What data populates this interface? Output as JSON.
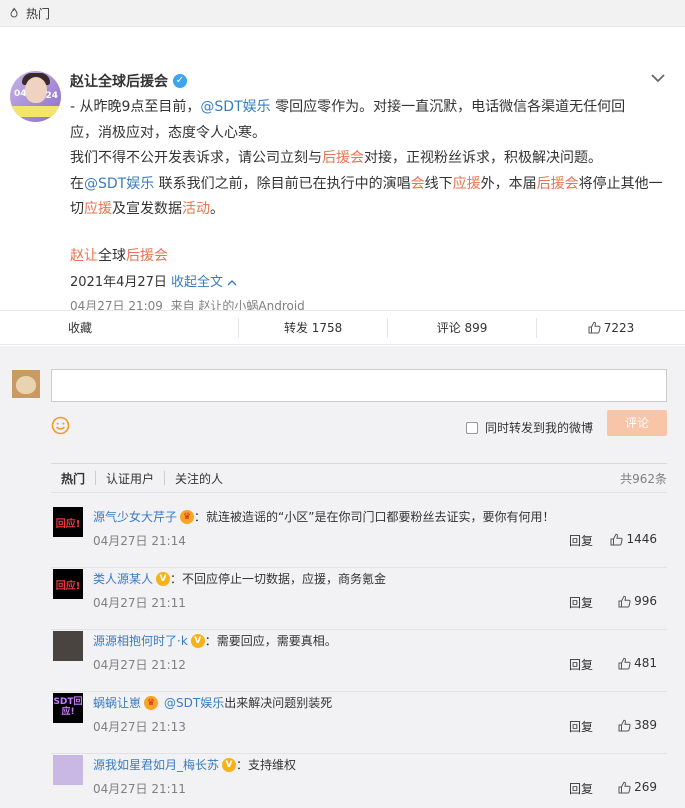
{
  "topbar": {
    "label": "热门"
  },
  "post": {
    "author": "赵让全球后援会",
    "avatar_text_left": "04",
    "avatar_text_right": "24",
    "line1_a": "- 从昨晚9点至目前，",
    "line1_at": "@SDT娱乐",
    "line1_b": " 零回应零作为。对接一直沉默，电话微信各渠道无任何回",
    "line2": "应，消极应对，态度令人心寒。",
    "line3_a": "我们不得不公开发表诉求，请公司立刻与",
    "line3_link": "后援会",
    "line3_b": "对接，正视粉丝诉求，积极解决问题。",
    "line4_a": "在",
    "line4_at": "@SDT娱乐",
    "line4_b": " 联系我们之前，除目前已在执行中的演唱",
    "line4_link1": "会",
    "line4_c": "线下",
    "line4_link2": "应援",
    "line4_d": "外，本届",
    "line4_link3": "后援会",
    "line4_e": "将停止其他一",
    "line5_a": "切",
    "line5_link1": "应援",
    "line5_b": "及宣发数据",
    "line5_link2": "活动",
    "line5_c": "。",
    "sig_a": "赵让",
    "sig_b": "全球",
    "sig_link": "后援会",
    "date": "2021年4月27日",
    "collapse": "收起全文",
    "meta_time": "04月27日 21:09",
    "meta_from": "来自 赵让的小蜗Android"
  },
  "actions": {
    "favorite": "收藏",
    "repost": "转发 1758",
    "comment": "评论 899",
    "like": "7223"
  },
  "composer": {
    "forward_label": "同时转发到我的微博",
    "submit": "评论"
  },
  "tabs": {
    "hot": "热门",
    "verified": "认证用户",
    "following": "关注的人",
    "total": "共962条"
  },
  "comments": [
    {
      "avatar_text": "回应!",
      "name": "源气少女大芹子",
      "badge": "crown",
      "text": "：就连被造谣的“小区”是在你司门口都要粉丝去证实，要你有何用！",
      "time": "04月27日 21:14",
      "reply": "回复",
      "likes": "1446"
    },
    {
      "avatar_text": "回应!",
      "name": "类人源某人",
      "badge": "v",
      "text": "：不回应停止一切数据，应援，商务氪金",
      "time": "04月27日 21:11",
      "reply": "回复",
      "likes": "996"
    },
    {
      "avatar_text": "",
      "name": "源源相抱何时了·k",
      "badge": "v",
      "text": "：需要回应，需要真相。",
      "time": "04月27日 21:12",
      "reply": "回复",
      "likes": "481"
    },
    {
      "avatar_text": "SDT回应!",
      "name": "蜗蜗让崽",
      "badge": "crown",
      "text_at": "@SDT娱乐",
      "text": " 出来解决问题别装死",
      "time": "04月27日 21:13",
      "reply": "回复",
      "likes": "389"
    },
    {
      "avatar_text": "",
      "name": "源我如星君如月_梅长苏",
      "badge": "v",
      "text": "：支持维权",
      "time": "04月27日 21:11",
      "reply": "回复",
      "likes": "269"
    }
  ],
  "colors": {
    "accent": "#eb7350",
    "link": "#3a7cc0",
    "submit_bg": "#f8c5a9",
    "verified": "#3da5ef"
  }
}
